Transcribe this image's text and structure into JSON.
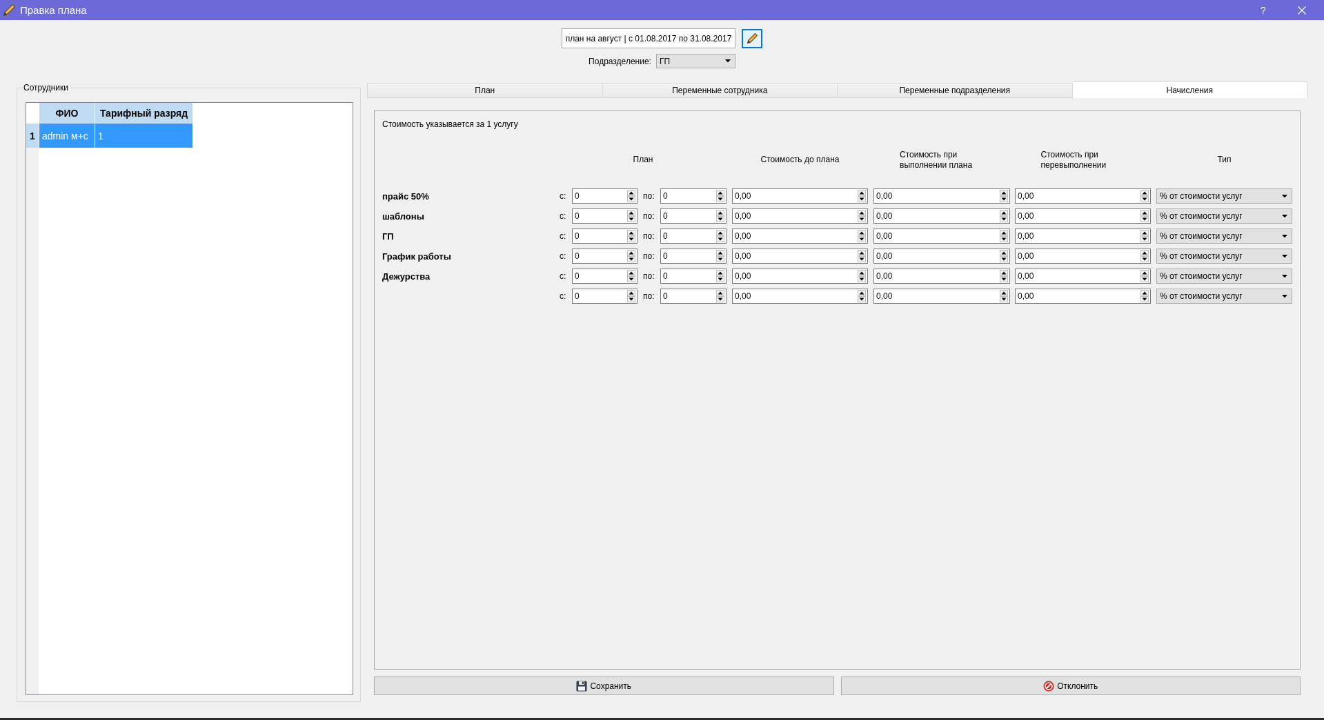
{
  "window": {
    "title": "Правка плана",
    "help": "?"
  },
  "plan_selector": {
    "value": "план на август | с 01.08.2017 по 31.08.2017",
    "edit_button": {
      "focused": true
    }
  },
  "subdivision": {
    "label": "Подразделение:",
    "value": "ГП"
  },
  "employees": {
    "title": "Сотрудники",
    "columns": [
      "ФИО",
      "Тарифный разряд"
    ],
    "rows": [
      {
        "number": "1",
        "selected": true,
        "cells": [
          {
            "text": "admin м+с",
            "focused": false
          },
          {
            "text": "1",
            "focused": true
          }
        ]
      }
    ]
  },
  "tabs": [
    {
      "label": "План",
      "selected": false
    },
    {
      "label": "Переменные сотрудника",
      "selected": false
    },
    {
      "label": "Переменные подразделения",
      "selected": false
    },
    {
      "label": "Начисления",
      "selected": true
    }
  ],
  "accruals": {
    "note": "Стоимость указывается за 1 услугу",
    "columns": [
      "План",
      "Стоимость до плана",
      "Стоимость при выполнении плана",
      "Стоимость при перевыполнении",
      "Тип"
    ],
    "rows": [
      {
        "name": "прайс 50%",
        "from_label": "с:",
        "from": "0",
        "to_label": "по:",
        "to": "0",
        "cost_before_plan": "0,00",
        "cost_plan_met": "0,00",
        "cost_plan_exceeded": "0,00",
        "type": "% от стоимости услуг"
      },
      {
        "name": "шаблоны",
        "from_label": "с:",
        "from": "0",
        "to_label": "по:",
        "to": "0",
        "cost_before_plan": "0,00",
        "cost_plan_met": "0,00",
        "cost_plan_exceeded": "0,00",
        "type": "% от стоимости услуг"
      },
      {
        "name": "ГП",
        "from_label": "с:",
        "from": "0",
        "to_label": "по:",
        "to": "0",
        "cost_before_plan": "0,00",
        "cost_plan_met": "0,00",
        "cost_plan_exceeded": "0,00",
        "type": "% от стоимости услуг"
      },
      {
        "name": "График работы",
        "from_label": "с:",
        "from": "0",
        "to_label": "по:",
        "to": "0",
        "cost_before_plan": "0,00",
        "cost_plan_met": "0,00",
        "cost_plan_exceeded": "0,00",
        "type": "% от стоимости услуг"
      },
      {
        "name": "Дежурства",
        "from_label": "с:",
        "from": "0",
        "to_label": "по:",
        "to": "0",
        "cost_before_plan": "0,00",
        "cost_plan_met": "0,00",
        "cost_plan_exceeded": "0,00",
        "type": "% от стоимости услуг"
      },
      {
        "from_label": "с:",
        "from": "0",
        "to_label": "по:",
        "to": "0",
        "cost_before_plan": "0,00",
        "cost_plan_met": "0,00",
        "cost_plan_exceeded": "0,00",
        "type": "% от стоимости услуг"
      }
    ]
  },
  "buttons": [
    {
      "kind": "save",
      "label": "Сохранить"
    },
    {
      "kind": "cancel",
      "label": "Отклонить"
    }
  ]
}
